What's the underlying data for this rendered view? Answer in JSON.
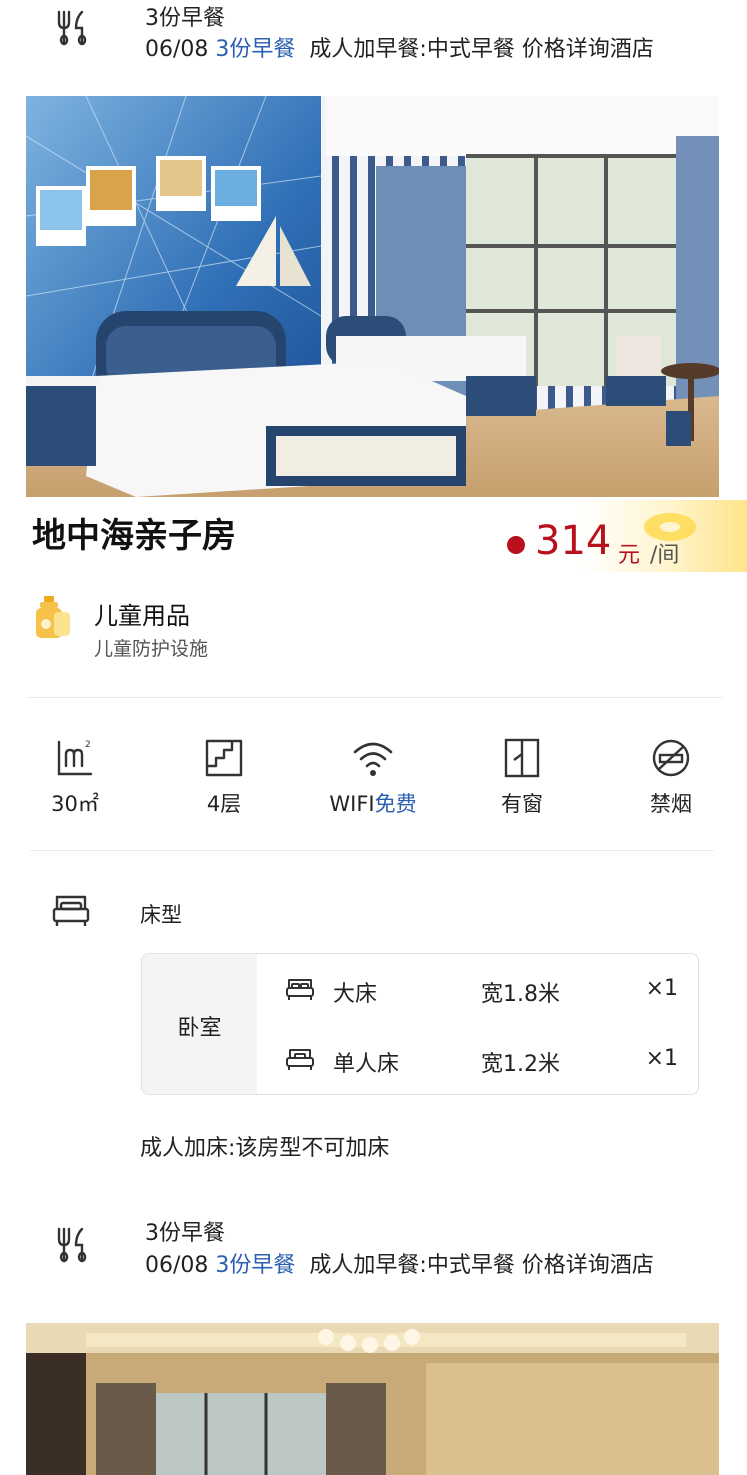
{
  "breakfast_top": {
    "title": "3份早餐",
    "date": "06/08",
    "count": "3份早餐",
    "desc": "成人加早餐:中式早餐 价格详询酒店"
  },
  "room": {
    "name": "地中海亲子房",
    "price": "314",
    "price_unit": "元",
    "price_per": "/间"
  },
  "kids": {
    "title": "儿童用品",
    "subtitle": "儿童防护设施"
  },
  "facilities": [
    {
      "label": "30㎡",
      "icon": "area-icon"
    },
    {
      "label": "4层",
      "icon": "floor-icon"
    },
    {
      "label_a": "WIFI",
      "label_b": "免费",
      "icon": "wifi-icon"
    },
    {
      "label": "有窗",
      "icon": "window-icon"
    },
    {
      "label": "禁烟",
      "icon": "no-smoking-icon"
    }
  ],
  "beds": {
    "label": "床型",
    "room": "卧室",
    "rows": [
      {
        "name": "大床",
        "width": "宽1.8米",
        "count": "×1"
      },
      {
        "name": "单人床",
        "width": "宽1.2米",
        "count": "×1"
      }
    ]
  },
  "extra_bed": "成人加床:该房型不可加床",
  "breakfast_bottom": {
    "title": "3份早餐",
    "date": "06/08",
    "count": "3份早餐",
    "desc": "成人加早餐:中式早餐 价格详询酒店"
  },
  "colors": {
    "price": "#b8101c",
    "link_blue": "#2a5fb0"
  }
}
